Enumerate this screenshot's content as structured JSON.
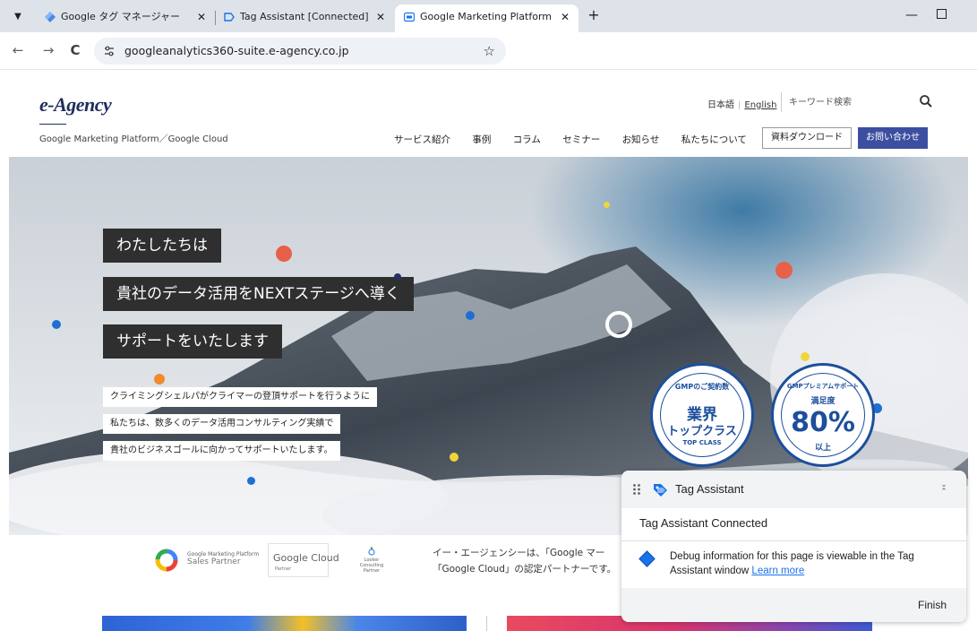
{
  "browser": {
    "tabs": [
      {
        "title": "Google タグ マネージャー",
        "close": "✕",
        "icon": "gtm-diamond-icon"
      },
      {
        "title": "Tag Assistant [Connected]",
        "close": "✕",
        "icon": "tag-assistant-tab-icon"
      },
      {
        "title": "Google Marketing Platform , Go",
        "close": "✕",
        "icon": "site-favicon-icon",
        "active": true
      }
    ],
    "new_tab": "+",
    "minimize": "—",
    "back": "←",
    "forward": "→",
    "reload": "C",
    "url": "googleanalytics360-suite.e-agency.co.jp",
    "bookmark": "☆"
  },
  "header": {
    "logo": "e-Agency",
    "tagline": "Google Marketing Platform／Google Cloud",
    "lang_ja": "日本語",
    "lang_separator": "|",
    "lang_en": "English",
    "search_placeholder": "キーワード検索",
    "nav": [
      "サービス紹介",
      "事例",
      "コラム",
      "セミナー",
      "お知らせ",
      "私たちについて"
    ],
    "download_button": "資料ダウンロード",
    "contact_button": "お問い合わせ"
  },
  "hero": {
    "catch_lines": [
      "わたしたちは",
      "貴社のデータ活用をNEXTステージへ導く",
      "サポートをいたします"
    ],
    "sub_lines": [
      "クライミングシェルパがクライマーの登頂サポートを行うように",
      "私たちは、数多くのデータ活用コンサルティング実績で",
      "貴社のビジネスゴールに向かってサポートいたします。"
    ],
    "badge1": {
      "top": "GMPのご契約数",
      "big": "業界",
      "big2": "トップクラス",
      "small": "TOP CLASS"
    },
    "badge2": {
      "top": "GMPプレミアムサポート",
      "small_top": "満足度",
      "big": "80%",
      "small": "以上"
    },
    "colors": {
      "red": "#e8604a",
      "blue": "#1f6fd1",
      "yellow": "#f0d43a",
      "orange": "#f28a2e",
      "navy": "#1c4f9c"
    }
  },
  "partners": {
    "gmp_line1": "Google Marketing Platform",
    "gmp_line2": "Sales Partner",
    "gc_name": "Google Cloud",
    "gc_sub": "Partner",
    "looker": "Looker Consulting Partner"
  },
  "intro": {
    "line1": "イー・エージェンシーは、「Google マー",
    "line2": "「Google Cloud」の認定パートナーです。"
  },
  "tag_assistant": {
    "title": "Tag Assistant",
    "status": "Tag Assistant Connected",
    "info_text": "Debug information for this page is viewable in the Tag Assistant window",
    "learn_more": "Learn more",
    "finish": "Finish",
    "collapse_icon": "chevron-collapse-icon"
  }
}
